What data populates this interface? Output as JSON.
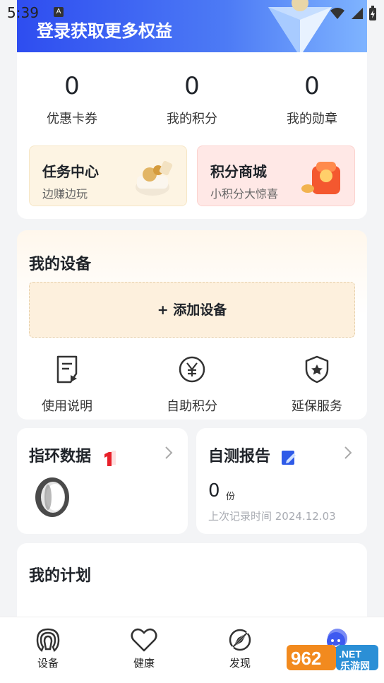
{
  "status": {
    "time": "5:39",
    "notif_glyph": "A"
  },
  "banner": {
    "title": "登录获取更多权益"
  },
  "stats": [
    {
      "value": "0",
      "label": "优惠卡券"
    },
    {
      "value": "0",
      "label": "我的积分"
    },
    {
      "value": "0",
      "label": "我的勋章"
    }
  ],
  "promos": [
    {
      "title": "任务中心",
      "subtitle": "边赚边玩",
      "color": "#fdf4e3"
    },
    {
      "title": "积分商城",
      "subtitle": "小积分大惊喜",
      "color": "#ffe8e6"
    }
  ],
  "device": {
    "title": "我的设备",
    "add_label": "+ 添加设备",
    "tools": [
      {
        "label": "使用说明",
        "icon": "manual-icon"
      },
      {
        "label": "自助积分",
        "icon": "yen-coin-icon"
      },
      {
        "label": "延保服务",
        "icon": "shield-star-icon"
      }
    ]
  },
  "ring_card": {
    "title": "指环数据"
  },
  "report_card": {
    "title": "自测报告",
    "count": "0",
    "unit": "份",
    "last_record": "上次记录时间 2024.12.03"
  },
  "plan": {
    "title": "我的计划"
  },
  "tabbar": {
    "items": [
      {
        "label": "设备",
        "icon": "device-icon"
      },
      {
        "label": "健康",
        "icon": "heart-icon"
      },
      {
        "label": "发现",
        "icon": "compass-icon"
      }
    ]
  },
  "watermark": {
    "text_top": "962.NET",
    "text_bottom": "乐游网"
  },
  "colors": {
    "accent": "#2e4df0",
    "text": "#1f2329",
    "muted": "#999999"
  }
}
